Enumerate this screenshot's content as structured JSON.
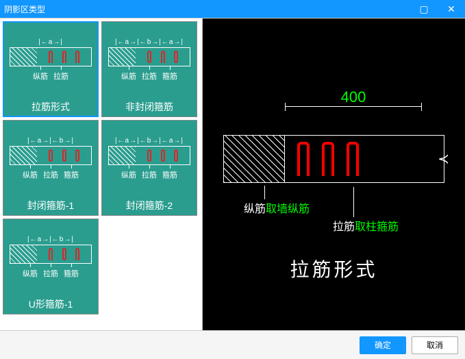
{
  "window": {
    "title": "阴影区类型"
  },
  "thumbnails": [
    {
      "caption": "拉筋形式",
      "dim": "|←a→|",
      "labels": [
        "纵筋",
        "拉筋"
      ],
      "selected": true
    },
    {
      "caption": "非封闭箍筋",
      "dim": "|←a→|←b→|←a→|",
      "labels": [
        "纵筋",
        "拉筋",
        "箍筋"
      ],
      "selected": false
    },
    {
      "caption": "封闭箍筋-1",
      "dim": "|←a→|←b→|",
      "labels": [
        "纵筋",
        "拉筋",
        "箍筋"
      ],
      "selected": false
    },
    {
      "caption": "封闭箍筋-2",
      "dim": "|←a→|←b→|←a→|",
      "labels": [
        "纵筋",
        "拉筋",
        "箍筋"
      ],
      "selected": false
    },
    {
      "caption": "U形箍筋-1",
      "dim": "|←a→|←b→|",
      "labels": [
        "纵筋",
        "拉筋",
        "箍筋"
      ],
      "selected": false
    }
  ],
  "preview": {
    "dimension": "400",
    "annot1_white": "纵筋",
    "annot1_green": "取墙纵筋",
    "annot2_white": "拉筋",
    "annot2_green": "取柱箍筋",
    "title": "拉筋形式"
  },
  "buttons": {
    "ok": "确定",
    "cancel": "取消"
  }
}
